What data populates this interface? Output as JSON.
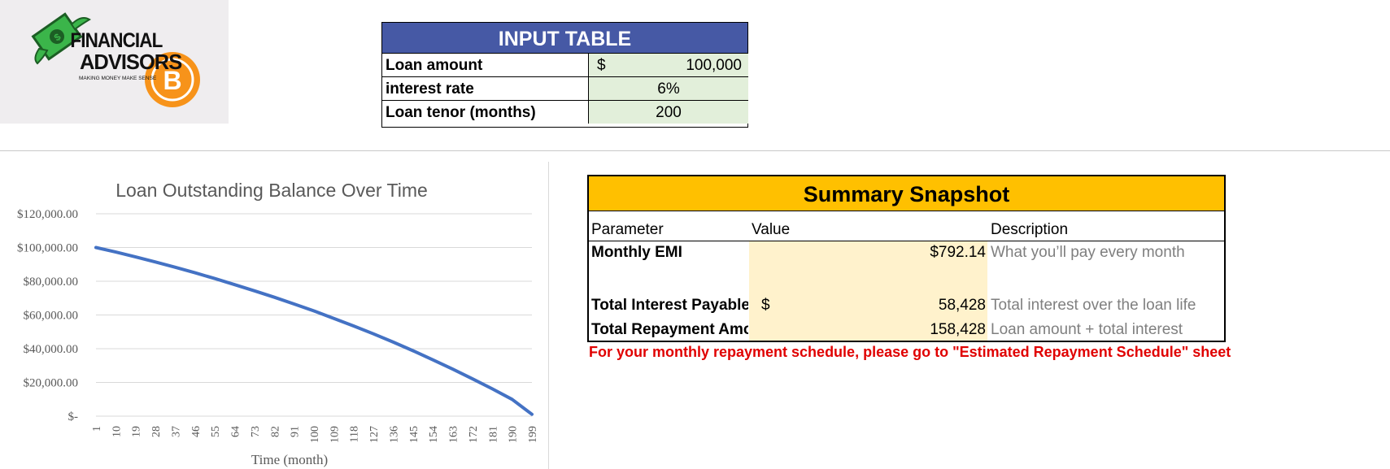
{
  "logo": {
    "line1": "FINANCIAL",
    "line2": "ADVISORS",
    "tagline": "MAKING MONEY MAKE SENSE",
    "icon": "money-bill-and-bitcoin-icon",
    "colors": {
      "green": "#3bb54a",
      "orange": "#f7931a"
    }
  },
  "input_table": {
    "title": "INPUT TABLE",
    "rows": [
      {
        "label": "Loan amount",
        "currency": "$",
        "value": "100,000"
      },
      {
        "label": "interest rate",
        "value": "6%"
      },
      {
        "label": "Loan tenor (months)",
        "value": "200"
      }
    ],
    "colors": {
      "header": "#4659a5",
      "value_fill": "#e2efda"
    }
  },
  "summary": {
    "title": "Summary Snapshot",
    "headers": {
      "parameter": "Parameter",
      "value": "Value",
      "description": "Description"
    },
    "rows": [
      {
        "label": "Monthly EMI",
        "currency": "",
        "value": "$792.14",
        "description": "What you’ll pay every month"
      },
      {
        "label": "Total Interest Payable",
        "currency": "$",
        "value": "58,428",
        "description": "Total interest over the loan life"
      },
      {
        "label": "Total Repayment Amount",
        "currency": "",
        "value": "158,428",
        "description": "Loan amount + total interest"
      }
    ],
    "note": "For your monthly repayment schedule, please go to \"Estimated Repayment Schedule\" sheet",
    "colors": {
      "header": "#ffc000",
      "value_fill": "#fff2cc",
      "note": "#e00000"
    }
  },
  "chart_data": {
    "type": "line",
    "title": "Loan Outstanding Balance Over Time",
    "xlabel": "Time (month)",
    "ylabel": "",
    "ylim": [
      0,
      120000
    ],
    "y_ticks": [
      "$120,000.00",
      "$100,000.00",
      "$80,000.00",
      "$60,000.00",
      "$40,000.00",
      "$20,000.00",
      "$-"
    ],
    "x_ticks": [
      "1",
      "10",
      "19",
      "28",
      "37",
      "46",
      "55",
      "64",
      "73",
      "82",
      "91",
      "100",
      "109",
      "118",
      "127",
      "136",
      "145",
      "154",
      "163",
      "172",
      "181",
      "190",
      "199"
    ],
    "grid": true,
    "legend": "none",
    "series": [
      {
        "color": "#4472c4",
        "x": [
          1,
          10,
          19,
          28,
          37,
          46,
          55,
          64,
          73,
          82,
          91,
          100,
          109,
          118,
          127,
          136,
          145,
          154,
          163,
          172,
          181,
          190,
          199
        ],
        "values": [
          100000,
          97300,
          94400,
          91400,
          88300,
          85000,
          81600,
          78000,
          74300,
          70500,
          66500,
          62400,
          58000,
          53500,
          48800,
          43900,
          38800,
          33400,
          27900,
          22100,
          16200,
          10000,
          1100
        ]
      }
    ]
  }
}
